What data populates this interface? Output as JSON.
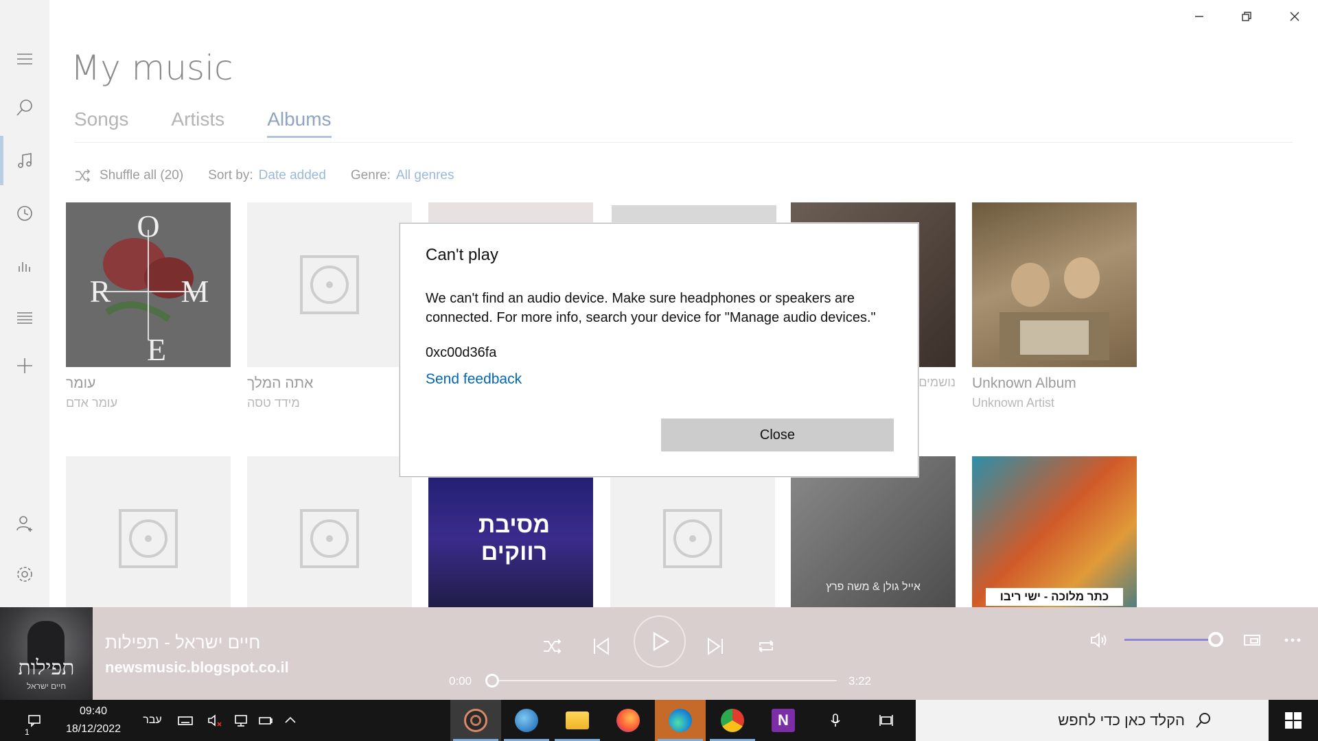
{
  "app": {
    "page_title": "My music",
    "tabs": [
      {
        "label": "Songs",
        "active": false
      },
      {
        "label": "Artists",
        "active": false
      },
      {
        "label": "Albums",
        "active": true
      }
    ],
    "toolbar": {
      "shuffle_label": "Shuffle all (20)",
      "sort_label": "Sort by:",
      "sort_value": "Date added",
      "genre_label": "Genre:",
      "genre_value": "All genres"
    },
    "accent_color": "#0067b8"
  },
  "albums_row1": [
    {
      "title": "עומר",
      "artist": "עומר אדם",
      "cover": "rose-art"
    },
    {
      "title": "אתה המלך",
      "artist": "מידד טסה",
      "cover": "placeholder"
    },
    {
      "title": "",
      "artist": "",
      "cover": "hidden"
    },
    {
      "title": "",
      "artist": "",
      "cover": "hidden"
    },
    {
      "title": "",
      "artist": "נושמים",
      "cover": "partial"
    },
    {
      "title": "Unknown Album",
      "artist": "Unknown Artist",
      "cover": "painting"
    }
  ],
  "albums_row2_cover_text": {
    "album3": "מסיבת רווקים",
    "album5": "אייל גולן & משה פרץ",
    "album6": "כתר מלוכה - ישי ריבו"
  },
  "dialog": {
    "title": "Can't play",
    "message": "We can't find an audio device. Make sure headphones or speakers are connected. For more info, search your device for \"Manage audio devices.\"",
    "code": "0xc00d36fa",
    "feedback_link": "Send feedback",
    "close_label": "Close"
  },
  "now_playing": {
    "title": "חיים ישראל - תפילות",
    "subtitle": "newsmusic.blogspot.co.il",
    "art_text": "תפילות",
    "art_subtext": "חיים ישראל",
    "elapsed": "0:00",
    "duration": "3:22",
    "progress": 0.0,
    "volume": 0.9
  },
  "taskbar": {
    "time": "09:40",
    "date": "18/12/2022",
    "language": "עבר",
    "notification_count": "1",
    "search_placeholder": "הקלד כאן כדי לחפש"
  }
}
